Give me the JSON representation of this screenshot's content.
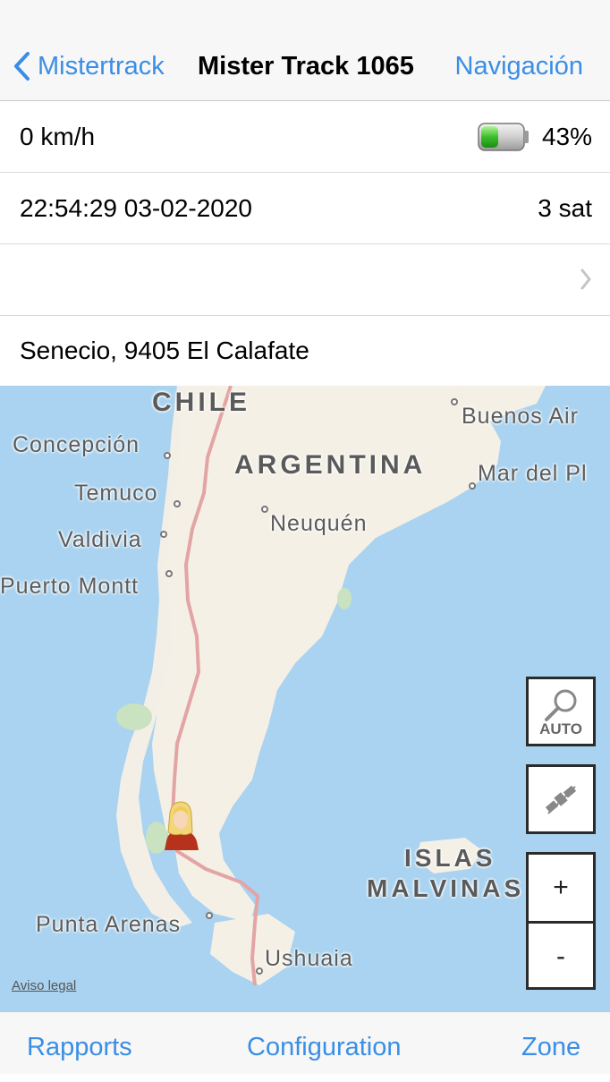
{
  "nav": {
    "back_label": "Mistertrack",
    "title": "Mister Track 1065",
    "right_label": "Navigación"
  },
  "info": {
    "speed": "0 km/h",
    "battery_percent": "43%",
    "battery_level": 0.43,
    "datetime": "22:54:29 03-02-2020",
    "satellites": "3 sat",
    "address": "Senecio, 9405 El Calafate"
  },
  "map": {
    "labels": {
      "chile": "CHILE",
      "argentina": "ARGENTINA",
      "buenos_aires": "Buenos Air",
      "mar_del_plata": "Mar del Pl",
      "concepcion": "Concepción",
      "temuco": "Temuco",
      "valdivia": "Valdivia",
      "neuquen": "Neuquén",
      "puerto_montt": "Puerto Montt",
      "islas": "ISLAS",
      "malvinas": "MALVINAS",
      "punta_arenas": "Punta Arenas",
      "ushuaia": "Ushuaia"
    },
    "legal": "Aviso legal",
    "auto_label": "AUTO",
    "zoom_in": "+",
    "zoom_out": "-",
    "colors": {
      "water": "#a9d3f0",
      "land": "#f5f0e6",
      "border": "#e3a4a4"
    }
  },
  "tabs": {
    "reports": "Rapports",
    "configuration": "Configuration",
    "zone": "Zone"
  },
  "accent": "#3a8ee6"
}
